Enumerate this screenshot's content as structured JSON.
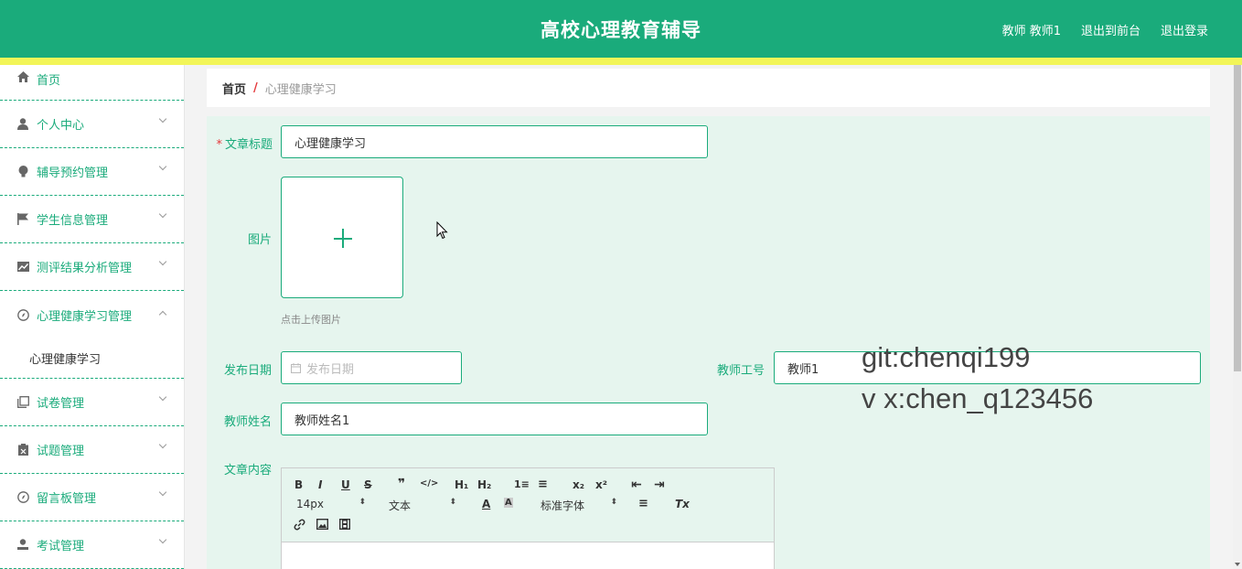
{
  "header": {
    "title": "高校心理教育辅导",
    "user_label": "教师 教师1",
    "to_frontend": "退出到前台",
    "logout": "退出登录"
  },
  "sidebar": {
    "items": [
      {
        "label": "首页",
        "icon": "home-icon"
      },
      {
        "label": "个人中心",
        "icon": "user-icon"
      },
      {
        "label": "辅导预约管理",
        "icon": "bulb-icon"
      },
      {
        "label": "学生信息管理",
        "icon": "flag-icon"
      },
      {
        "label": "测评结果分析管理",
        "icon": "chart-icon"
      },
      {
        "label": "心理健康学习管理",
        "icon": "compass-icon",
        "expanded": true
      },
      {
        "label": "试卷管理",
        "icon": "copy-icon"
      },
      {
        "label": "试题管理",
        "icon": "clipboard-icon"
      },
      {
        "label": "留言板管理",
        "icon": "compass-icon"
      },
      {
        "label": "考试管理",
        "icon": "user-icon"
      }
    ],
    "sub_item": "心理健康学习"
  },
  "breadcrumb": {
    "home": "首页",
    "sep": "/",
    "current": "心理健康学习"
  },
  "form": {
    "title_label": "文章标题",
    "title_required": "*",
    "title_value": "心理健康学习",
    "image_label": "图片",
    "upload_tip": "点击上传图片",
    "date_label": "发布日期",
    "date_placeholder": "发布日期",
    "teacher_id_label": "教师工号",
    "teacher_id_value": "教师1",
    "teacher_name_label": "教师姓名",
    "teacher_name_value": "教师姓名1",
    "content_label": "文章内容"
  },
  "editor": {
    "bold": "B",
    "italic": "I",
    "underline": "U",
    "strike": "S",
    "quote": "❞",
    "code": "</>",
    "h1": "H₁",
    "h2": "H₂",
    "ordered": "1≡",
    "bullet": "≡",
    "sub": "x₂",
    "sup": "x²",
    "outdent": "⇤",
    "indent": "⇥",
    "size": "14px",
    "type": "文本",
    "font": "标准字体",
    "clear": "Tx"
  },
  "watermark": {
    "line1": "git:chenqi199",
    "line2": "v x:chen_q123456"
  },
  "colors": {
    "primary": "#1aab7b",
    "stripe": "#f2f558",
    "panel_bg": "#e6f5ee"
  }
}
